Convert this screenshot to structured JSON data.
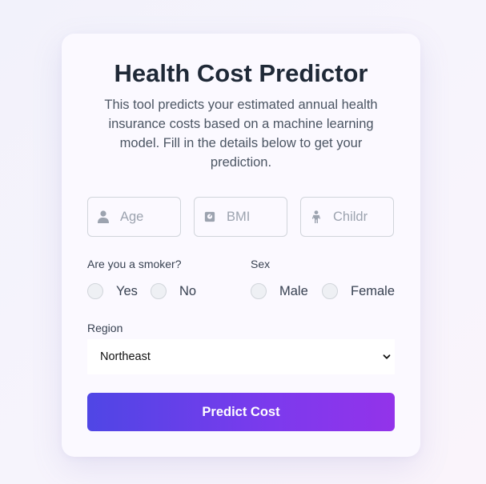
{
  "title": "Health Cost Predictor",
  "description": "This tool predicts your estimated annual health insurance costs based on a machine learning model. Fill in the details below to get your prediction.",
  "inputs": {
    "age": {
      "placeholder": "Age",
      "icon": "person-icon"
    },
    "bmi": {
      "placeholder": "BMI",
      "icon": "scale-icon"
    },
    "children": {
      "placeholder": "Childr",
      "icon": "child-icon"
    }
  },
  "smoker": {
    "label": "Are you a smoker?",
    "options": [
      "Yes",
      "No"
    ]
  },
  "sex": {
    "label": "Sex",
    "options": [
      "Male",
      "Female"
    ]
  },
  "region": {
    "label": "Region",
    "selected": "Northeast"
  },
  "submit_label": "Predict Cost",
  "colors": {
    "accent_start": "#4f46e5",
    "accent_end": "#9333ea",
    "title": "#1f2937"
  }
}
